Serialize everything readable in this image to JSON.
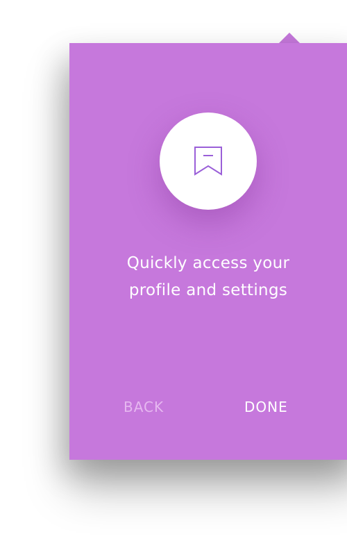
{
  "onboarding": {
    "message_line1": "Quickly access your",
    "message_line2": "profile and settings",
    "back_label": "BACK",
    "done_label": "DONE",
    "icon": "bookmark-icon"
  },
  "colors": {
    "card_background": "#c678dc",
    "icon_stroke": "#9a5fd8",
    "back_text": "#e6b8f0",
    "done_text": "#ffffff"
  }
}
